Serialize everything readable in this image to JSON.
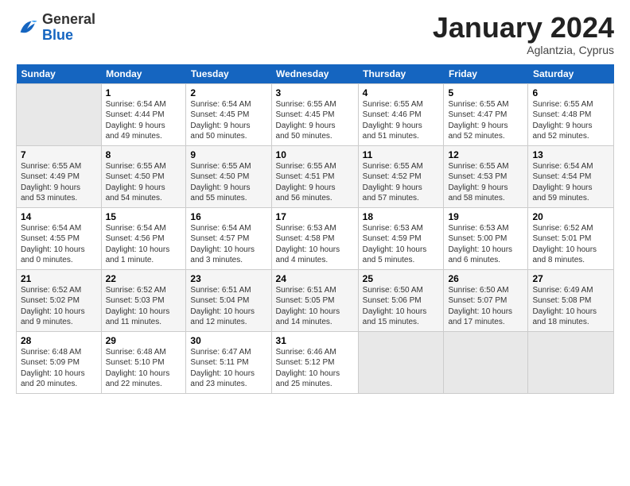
{
  "logo": {
    "general": "General",
    "blue": "Blue"
  },
  "title": "January 2024",
  "subtitle": "Aglantzia, Cyprus",
  "headers": [
    "Sunday",
    "Monday",
    "Tuesday",
    "Wednesday",
    "Thursday",
    "Friday",
    "Saturday"
  ],
  "weeks": [
    [
      {
        "day": "",
        "info": ""
      },
      {
        "day": "1",
        "info": "Sunrise: 6:54 AM\nSunset: 4:44 PM\nDaylight: 9 hours\nand 49 minutes."
      },
      {
        "day": "2",
        "info": "Sunrise: 6:54 AM\nSunset: 4:45 PM\nDaylight: 9 hours\nand 50 minutes."
      },
      {
        "day": "3",
        "info": "Sunrise: 6:55 AM\nSunset: 4:45 PM\nDaylight: 9 hours\nand 50 minutes."
      },
      {
        "day": "4",
        "info": "Sunrise: 6:55 AM\nSunset: 4:46 PM\nDaylight: 9 hours\nand 51 minutes."
      },
      {
        "day": "5",
        "info": "Sunrise: 6:55 AM\nSunset: 4:47 PM\nDaylight: 9 hours\nand 52 minutes."
      },
      {
        "day": "6",
        "info": "Sunrise: 6:55 AM\nSunset: 4:48 PM\nDaylight: 9 hours\nand 52 minutes."
      }
    ],
    [
      {
        "day": "7",
        "info": "Sunrise: 6:55 AM\nSunset: 4:49 PM\nDaylight: 9 hours\nand 53 minutes."
      },
      {
        "day": "8",
        "info": "Sunrise: 6:55 AM\nSunset: 4:50 PM\nDaylight: 9 hours\nand 54 minutes."
      },
      {
        "day": "9",
        "info": "Sunrise: 6:55 AM\nSunset: 4:50 PM\nDaylight: 9 hours\nand 55 minutes."
      },
      {
        "day": "10",
        "info": "Sunrise: 6:55 AM\nSunset: 4:51 PM\nDaylight: 9 hours\nand 56 minutes."
      },
      {
        "day": "11",
        "info": "Sunrise: 6:55 AM\nSunset: 4:52 PM\nDaylight: 9 hours\nand 57 minutes."
      },
      {
        "day": "12",
        "info": "Sunrise: 6:55 AM\nSunset: 4:53 PM\nDaylight: 9 hours\nand 58 minutes."
      },
      {
        "day": "13",
        "info": "Sunrise: 6:54 AM\nSunset: 4:54 PM\nDaylight: 9 hours\nand 59 minutes."
      }
    ],
    [
      {
        "day": "14",
        "info": "Sunrise: 6:54 AM\nSunset: 4:55 PM\nDaylight: 10 hours\nand 0 minutes."
      },
      {
        "day": "15",
        "info": "Sunrise: 6:54 AM\nSunset: 4:56 PM\nDaylight: 10 hours\nand 1 minute."
      },
      {
        "day": "16",
        "info": "Sunrise: 6:54 AM\nSunset: 4:57 PM\nDaylight: 10 hours\nand 3 minutes."
      },
      {
        "day": "17",
        "info": "Sunrise: 6:53 AM\nSunset: 4:58 PM\nDaylight: 10 hours\nand 4 minutes."
      },
      {
        "day": "18",
        "info": "Sunrise: 6:53 AM\nSunset: 4:59 PM\nDaylight: 10 hours\nand 5 minutes."
      },
      {
        "day": "19",
        "info": "Sunrise: 6:53 AM\nSunset: 5:00 PM\nDaylight: 10 hours\nand 6 minutes."
      },
      {
        "day": "20",
        "info": "Sunrise: 6:52 AM\nSunset: 5:01 PM\nDaylight: 10 hours\nand 8 minutes."
      }
    ],
    [
      {
        "day": "21",
        "info": "Sunrise: 6:52 AM\nSunset: 5:02 PM\nDaylight: 10 hours\nand 9 minutes."
      },
      {
        "day": "22",
        "info": "Sunrise: 6:52 AM\nSunset: 5:03 PM\nDaylight: 10 hours\nand 11 minutes."
      },
      {
        "day": "23",
        "info": "Sunrise: 6:51 AM\nSunset: 5:04 PM\nDaylight: 10 hours\nand 12 minutes."
      },
      {
        "day": "24",
        "info": "Sunrise: 6:51 AM\nSunset: 5:05 PM\nDaylight: 10 hours\nand 14 minutes."
      },
      {
        "day": "25",
        "info": "Sunrise: 6:50 AM\nSunset: 5:06 PM\nDaylight: 10 hours\nand 15 minutes."
      },
      {
        "day": "26",
        "info": "Sunrise: 6:50 AM\nSunset: 5:07 PM\nDaylight: 10 hours\nand 17 minutes."
      },
      {
        "day": "27",
        "info": "Sunrise: 6:49 AM\nSunset: 5:08 PM\nDaylight: 10 hours\nand 18 minutes."
      }
    ],
    [
      {
        "day": "28",
        "info": "Sunrise: 6:48 AM\nSunset: 5:09 PM\nDaylight: 10 hours\nand 20 minutes."
      },
      {
        "day": "29",
        "info": "Sunrise: 6:48 AM\nSunset: 5:10 PM\nDaylight: 10 hours\nand 22 minutes."
      },
      {
        "day": "30",
        "info": "Sunrise: 6:47 AM\nSunset: 5:11 PM\nDaylight: 10 hours\nand 23 minutes."
      },
      {
        "day": "31",
        "info": "Sunrise: 6:46 AM\nSunset: 5:12 PM\nDaylight: 10 hours\nand 25 minutes."
      },
      {
        "day": "",
        "info": ""
      },
      {
        "day": "",
        "info": ""
      },
      {
        "day": "",
        "info": ""
      }
    ]
  ]
}
